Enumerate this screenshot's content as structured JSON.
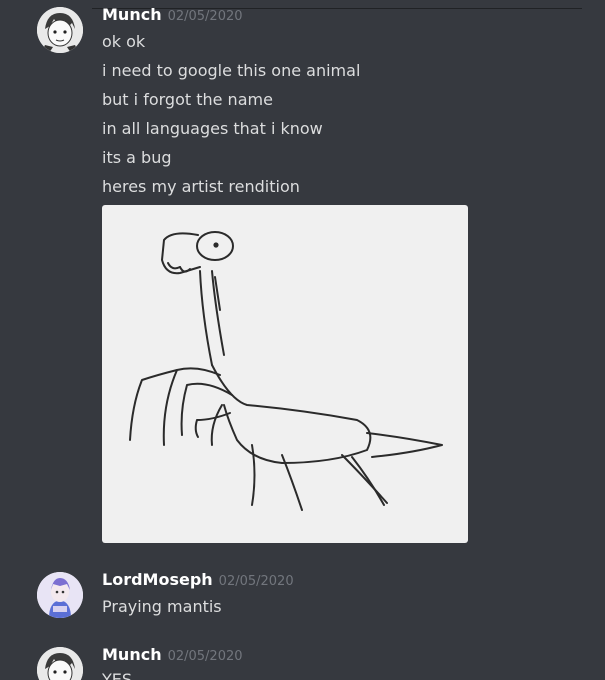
{
  "messages": [
    {
      "author": "Munch",
      "timestamp": "02/05/2020",
      "lines": [
        "ok ok",
        "i need to google this one animal",
        "but i forgot the name",
        "in all languages that i know",
        "its a bug",
        "heres my artist rendition"
      ],
      "attachment": {
        "type": "image",
        "icon": "mantis-drawing"
      }
    },
    {
      "author": "LordMoseph",
      "timestamp": "02/05/2020",
      "lines": [
        "Praying mantis"
      ]
    },
    {
      "author": "Munch",
      "timestamp": "02/05/2020",
      "lines": [
        "YES"
      ]
    }
  ],
  "colors": {
    "background": "#36393f",
    "username": "#ffffff",
    "timestamp": "#72767d",
    "text": "#dcddde"
  }
}
